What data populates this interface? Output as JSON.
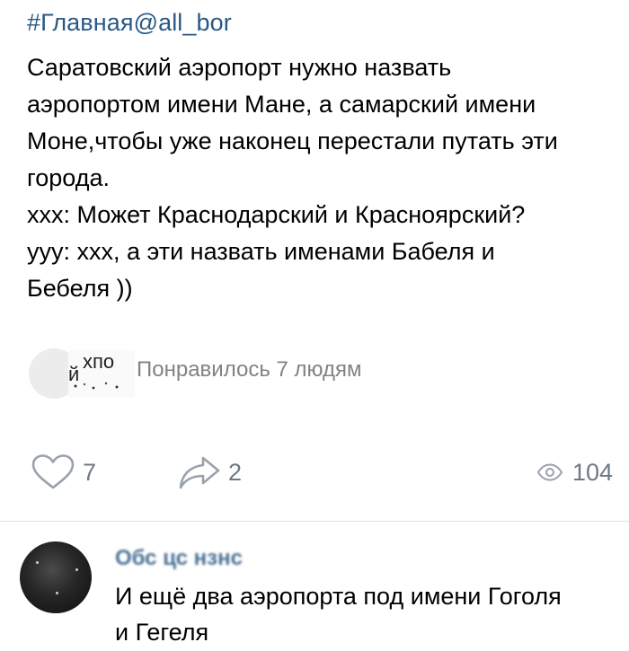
{
  "post": {
    "hashtag": "#Главная@all_bor",
    "text_lines": [
      "Саратовский аэропорт нужно назвать",
      "аэропортом имени Мане, а самарский имени",
      "Моне,чтобы уже наконец перестали путать эти",
      "города.",
      "ххх: Может Краснодарский и Красноярский?",
      "ууу: ххх, а эти назвать именами Бабеля и",
      "Бебеля ))"
    ]
  },
  "likes_summary": {
    "avatar_overlay_top": "хпо",
    "avatar_overlay_bottom": "й",
    "text": "Понравилось 7 людям"
  },
  "actions": {
    "likes_count": "7",
    "shares_count": "2",
    "views_count": "104",
    "icons": {
      "like": "heart-outline-icon",
      "share": "share-arrow-icon",
      "views": "eye-icon"
    },
    "icon_color": "#99a2ad"
  },
  "comment": {
    "author": "Обс цс нзнс",
    "text_lines": [
      "И ещё два аэропорта под имени Гоголя",
      "и Гегеля"
    ]
  },
  "colors": {
    "link": "#2a5885",
    "secondary_text": "#828282",
    "counter_text": "#6d7885",
    "divider": "#dfe1e5"
  }
}
